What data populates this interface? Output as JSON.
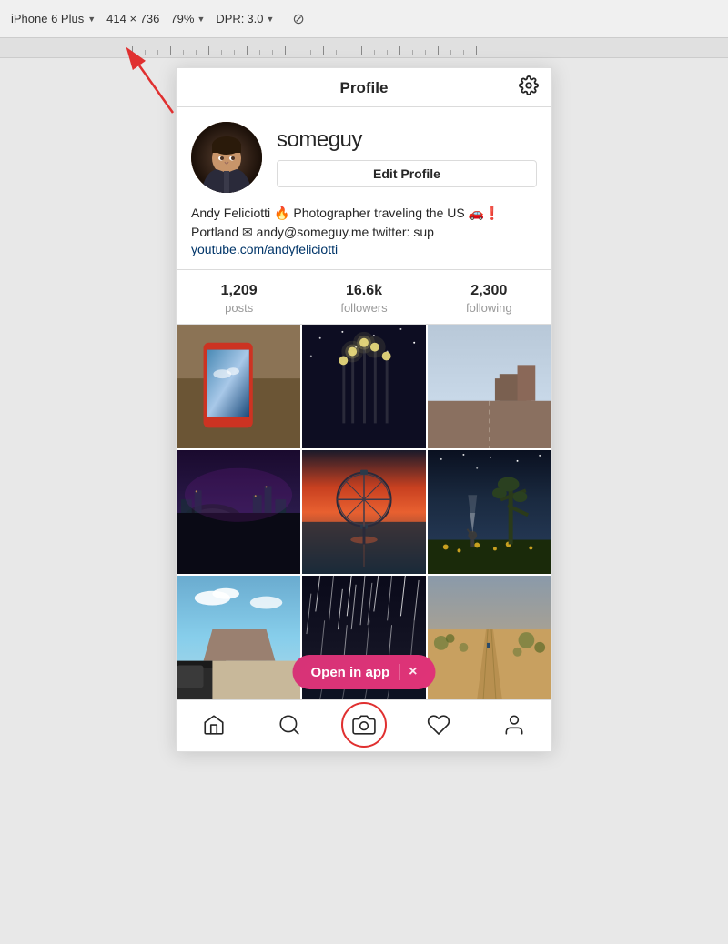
{
  "browser_bar": {
    "device": "iPhone 6 Plus",
    "dropdown_arrow": "▼",
    "separator": "×",
    "width": "414",
    "height": "736",
    "zoom": "79%",
    "zoom_arrow": "▼",
    "dpr_label": "DPR:",
    "dpr_value": "3.0",
    "dpr_arrow": "▼"
  },
  "profile": {
    "header_title": "Profile",
    "username": "someguy",
    "edit_button": "Edit Profile",
    "bio_line1": "Andy Feliciotti 🔥 Photographer traveling the US 🚗❗",
    "bio_line2": "Portland ✉ andy@someguy.me twitter: sup",
    "bio_link": "youtube.com/andyfeliciotti",
    "stats": {
      "posts_count": "1,209",
      "posts_label": "posts",
      "followers_count": "16.6k",
      "followers_label": "followers",
      "following_count": "2,300",
      "following_label": "following"
    }
  },
  "open_in_app": {
    "label": "Open in app",
    "close_symbol": "×"
  },
  "nav": {
    "home_icon": "⌂",
    "search_icon": "🔍",
    "camera_icon": "📷",
    "heart_icon": "♡",
    "profile_icon": "👤"
  },
  "grid_colors": [
    [
      "#8b7355",
      "#d2691e",
      "#cd853f"
    ],
    [
      "#2f2f3a",
      "#ff6b35",
      "#3a6b8a"
    ],
    [
      "#87ceeb",
      "#6b8cba",
      "#c8a96e"
    ]
  ]
}
